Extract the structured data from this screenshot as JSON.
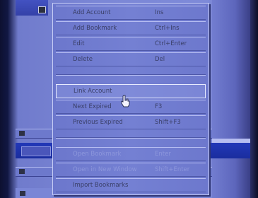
{
  "context_menu": {
    "items": [
      {
        "label": "Add Account",
        "shortcut": "Ins"
      },
      {
        "label": "Add Bookmark",
        "shortcut": "Ctrl+Ins"
      },
      {
        "label": "Edit",
        "shortcut": "Ctrl+Enter"
      },
      {
        "label": "Delete",
        "shortcut": "Del"
      },
      {
        "label": "Link Account",
        "shortcut": ""
      },
      {
        "label": "Next Expired",
        "shortcut": "F3"
      },
      {
        "label": "Previous Expired",
        "shortcut": "Shift+F3"
      },
      {
        "label": "Open Bookmark",
        "shortcut": "Enter"
      },
      {
        "label": "Open in New Window",
        "shortcut": "Shift+Enter"
      },
      {
        "label": "Import Bookmarks",
        "shortcut": ""
      }
    ],
    "hovered_index": 4,
    "disabled_indices": [
      7,
      8
    ]
  },
  "icons": {
    "cursor": "hand-pointer-icon",
    "window": "window-icon",
    "scroll": "scroll-arrow-icon"
  },
  "colors": {
    "menu_bg": "#7480d3",
    "background": "#7b87d6",
    "highlight_band": "#2238b8",
    "menu_text": "#3a3f68"
  }
}
